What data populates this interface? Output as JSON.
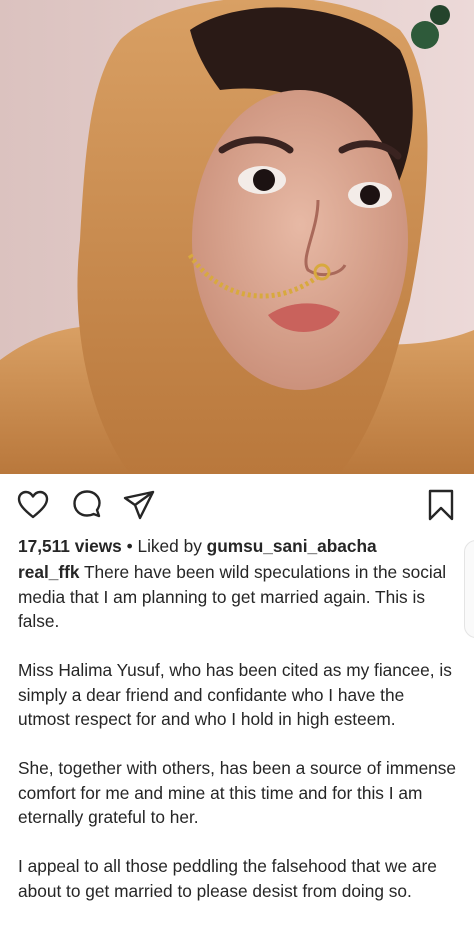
{
  "post": {
    "views_count": "17,511 views",
    "liked_by_prefix": "Liked by",
    "liked_by_user": "gumsu_sani_abacha",
    "separator": "•",
    "author": "real_ffk",
    "caption_first": "There have been wild speculations in the social media that I am planning to get married again. This is false.",
    "caption_paragraphs": [
      "Miss Halima Yusuf, who has been cited as my fiancee, is simply a dear friend and confidante who I have the utmost respect for and who I hold in high esteem.",
      "She, together with others, has been a source of immense comfort for me and mine at this time and for this I am eternally grateful to her.",
      "I appeal to all those peddling the falsehood that we are about to get married to please desist from doing so."
    ]
  },
  "icons": {
    "like": "heart-outline-icon",
    "comment": "comment-bubble-icon",
    "share": "paper-plane-icon",
    "save": "bookmark-icon"
  },
  "colors": {
    "text": "#262626",
    "scarf": "#c98a4a",
    "background_wall": "#e6cfcb"
  }
}
